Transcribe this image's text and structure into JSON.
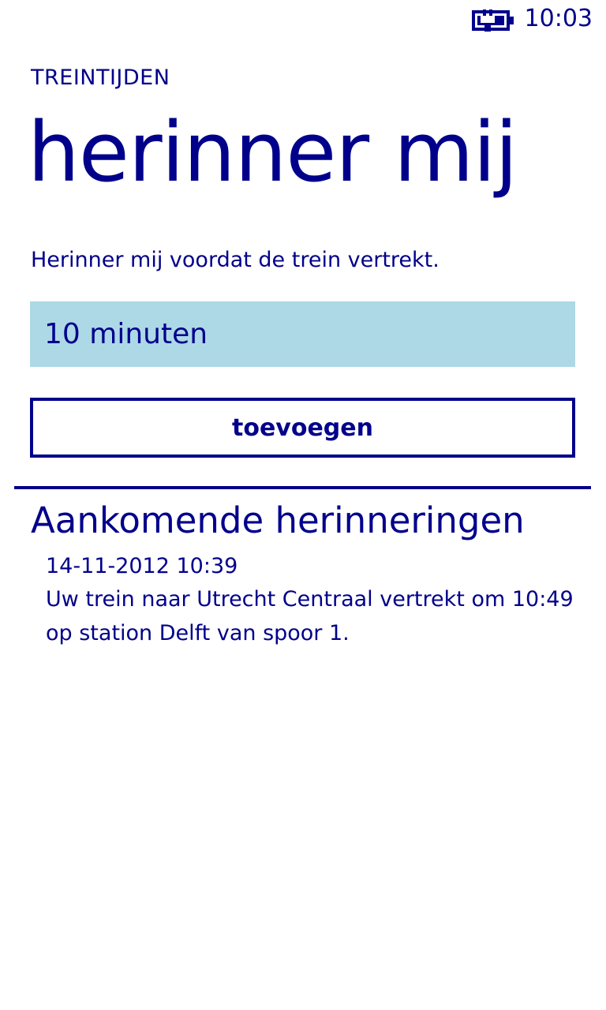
{
  "status_bar": {
    "battery_icon": "battery-charging-icon",
    "time": "10:03"
  },
  "header": {
    "app_title": "TREINTIJDEN",
    "page_title": "herinner mij"
  },
  "form": {
    "instruction": "Herinner mij voordat de trein vertrekt.",
    "selected_minutes": "10 minuten",
    "add_button_label": "toevoegen"
  },
  "upcoming": {
    "heading": "Aankomende herinneringen",
    "items": [
      {
        "datetime": "14-11-2012 10:39",
        "message": "Uw trein naar Utrecht Centraal vertrekt om 10:49 op station Delft van spoor 1."
      }
    ]
  },
  "colors": {
    "accent": "#00008B",
    "select_background": "#ADD8E6",
    "background": "#FFFFFF"
  }
}
